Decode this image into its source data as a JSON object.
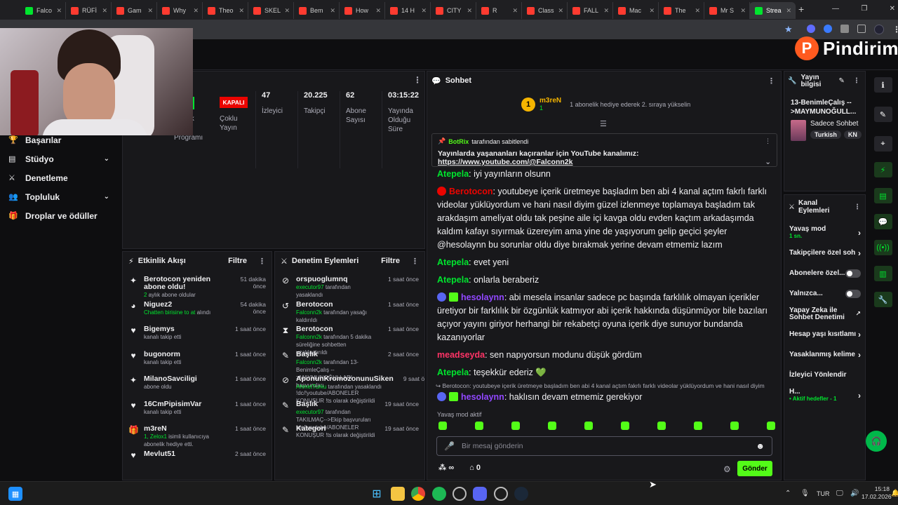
{
  "browser": {
    "tabs": [
      {
        "label": "Falco",
        "color": "#00e52e"
      },
      {
        "label": "RÜFİ",
        "color": "#ff3b30"
      },
      {
        "label": "Gam",
        "color": "#ff3b30"
      },
      {
        "label": "Why",
        "color": "#ff3b30"
      },
      {
        "label": "Theo",
        "color": "#ff3b30"
      },
      {
        "label": "SKEL",
        "color": "#ff3b30"
      },
      {
        "label": "Bem",
        "color": "#ff3b30"
      },
      {
        "label": "How",
        "color": "#ff3b30"
      },
      {
        "label": "14 H",
        "color": "#ff3b30"
      },
      {
        "label": "CITY",
        "color": "#ff3b30"
      },
      {
        "label": "R",
        "color": "#ff3b30"
      },
      {
        "label": "Class",
        "color": "#ff3b30"
      },
      {
        "label": "FALL",
        "color": "#ff3b30"
      },
      {
        "label": "Mac",
        "color": "#ff3b30"
      },
      {
        "label": "The",
        "color": "#ff3b30"
      },
      {
        "label": "Mr S",
        "color": "#ff3b30"
      },
      {
        "label": "Strea",
        "color": "#00e52e"
      }
    ],
    "new_tab": "+",
    "window_controls": [
      "—",
      "❐",
      "✕"
    ]
  },
  "brand": {
    "name": "Pindirim",
    "color": "#ff5a1f"
  },
  "left_nav": [
    {
      "label": "Başarılar",
      "icon": "trophy-icon",
      "glyph": "🏆",
      "chevron": false
    },
    {
      "label": "Stüdyo",
      "icon": "studio-icon",
      "glyph": "▤",
      "chevron": true
    },
    {
      "label": "Denetleme",
      "icon": "sword-icon",
      "glyph": "⚔",
      "chevron": false
    },
    {
      "label": "Topluluk",
      "icon": "community-icon",
      "glyph": "👥",
      "chevron": true
    },
    {
      "label": "Droplar ve ödüller",
      "icon": "gift-icon",
      "glyph": "🎁",
      "chevron": false
    }
  ],
  "stats": {
    "partial_label_1": "rlik",
    "partial_label_2": "Programı",
    "status_badge": "KAPALI",
    "multi_stream": "Çoklu Yayın",
    "items": [
      {
        "value": "47",
        "label": "İzleyici"
      },
      {
        "value": "20.225",
        "label": "Takipçi"
      },
      {
        "value": "62",
        "label": "Abone Sayısı"
      },
      {
        "value": "03:15:22",
        "label": "Yayında Olduğu Süre"
      }
    ]
  },
  "activity": {
    "title": "Etkinlik Akışı",
    "filter": "Filtre",
    "items": [
      {
        "icon": "✦",
        "name": "Berotocon yeniden abone oldu!",
        "sub_green": "2",
        "sub": " aylık abone oldular",
        "time": "51 dakika önce"
      },
      {
        "icon": "◕",
        "name": "Niguez2",
        "sub_green": "Chatten birisine to at",
        "sub": " alındı",
        "time": "54 dakika önce"
      },
      {
        "icon": "♥",
        "name": "Bigemys",
        "sub_green": "",
        "sub": "kanalı takip etti",
        "time": "1 saat önce"
      },
      {
        "icon": "♥",
        "name": "bugonorm",
        "sub_green": "",
        "sub": "kanalı takip etti",
        "time": "1 saat önce"
      },
      {
        "icon": "✦",
        "name": "MilanoSavciligi",
        "sub_green": "",
        "sub": "abone oldu",
        "time": "1 saat önce"
      },
      {
        "icon": "♥",
        "name": "16CmPipisimVar",
        "sub_green": "",
        "sub": "kanalı takip etti",
        "time": "1 saat önce"
      },
      {
        "icon": "🎁",
        "name": "m3reN",
        "sub_green": "1, Zelox1",
        "sub": " isimli kullanıcıya abonelik hediye etti.",
        "time": "1 saat önce"
      },
      {
        "icon": "♥",
        "name": "Mevlut51",
        "sub_green": "",
        "sub": "",
        "time": "2 saat önce"
      }
    ]
  },
  "moderation": {
    "title": "Denetim Eylemleri",
    "filter": "Filtre",
    "items": [
      {
        "icon": "⊘",
        "name": "orspuoglumnq",
        "sub_green": "executor97",
        "sub": " tarafından yasaklandı",
        "time": "1 saat önce"
      },
      {
        "icon": "↺",
        "name": "Berotocon",
        "sub_green": "Falconn2k",
        "sub": " tarafından yasağı kaldırıldı",
        "time": "1 saat önce"
      },
      {
        "icon": "⧗",
        "name": "Berotocon",
        "sub_green": "Falconn2k",
        "sub": " tarafından 5 dakika süreliğine sohbetten uzaklaştırıldı",
        "time": "1 saat önce"
      },
      {
        "icon": "✎",
        "name": "Başlık",
        "sub_green": "Falconn2k",
        "sub": " tarafından 13-BenimleÇalış -->MAYMUNOĞULLARI başvuruları !dc/!youtube/ABONELER KONUŞUR !ts olarak değiştirildi",
        "time": "2 saat önce"
      },
      {
        "icon": "⊘",
        "name": "AponunKromozonunuSiken",
        "sub_green": "AhmetTurku",
        "sub": " tarafından yasaklandı",
        "time": "9 saat önce"
      },
      {
        "icon": "✎",
        "name": "Başlık",
        "sub_green": "executor97",
        "sub": " tarafından TAKILMAÇ-->Ekip başvuruları !dc/!youtube/ABONELER KONUŞUR !ts olarak değiştirildi",
        "time": "19 saat önce"
      },
      {
        "icon": "✎",
        "name": "Kategori",
        "sub_green": "",
        "sub": "",
        "time": "19 saat önce"
      }
    ]
  },
  "chat": {
    "title": "Sohbet",
    "top_gifter": {
      "name": "m3reN",
      "rank": "1",
      "count": "1",
      "text": "1 abonelik hediye ederek 2. sıraya yükselin"
    },
    "pinned": {
      "by": "BotRix",
      "by_suffix": " tarafından sabitlendi",
      "text": "Yayınlarda yaşananları kaçıranlar için YouTube kanalımız: ",
      "link": "https://www.youtube.com/@Falconn2k"
    },
    "messages": [
      {
        "user": "Atepela",
        "color": "#00e52e",
        "badge": "",
        "text": ": iyi yayınların olsunn"
      },
      {
        "user": "Berotocon",
        "color": "#eb0400",
        "badge": "#eb0400",
        "text": ": youtubeye içerik üretmeye başladım ben abi 4 kanal açtım fakrlı farklı videolar yüklüyordum ve hani nasıl diyim güzel izlenmeye toplamaya başladım tak arakdaşım ameliyat oldu tak peşine aile içi kavga oldu evden kaçtım arkadaşımda kaldım kafayı sıyırmak üzereyim ama yine de yaşıyorum gelip geçici şeyler @hesolaynn bu sorunlar oldu diye bırakmak yerine devam etmemiz lazım"
      },
      {
        "user": "Atepela",
        "color": "#00e52e",
        "badge": "",
        "text": ": evet yeni"
      },
      {
        "user": "Atepela",
        "color": "#00e52e",
        "badge": "",
        "text": ": onlarla beraberiz"
      },
      {
        "user": "hesolaynn",
        "color": "#9147ff",
        "badge": "#5865f2",
        "text": ": abi mesela insanlar sadece pc başında farklılık olmayan içerikler üretiyor bir farklılık bir özgünlük katmıyor abi içerik hakkında düşünmüyor bile bazıları açıyor yayını giriyor herhangi bir rekabetçi oyuna içerik diye sunuyor bundanda kazanıyorlar"
      },
      {
        "user": "meadseyda",
        "color": "#ff3366",
        "badge": "",
        "text": ": sen napıyorsun modunu düşük gördüm"
      },
      {
        "user": "Atepela",
        "color": "#00e52e",
        "badge": "",
        "text": ": teşekkür ederiz 💚"
      }
    ],
    "reply_preview": "↪ Berotocon: youtubeye içerik üretmeye başladım ben abi 4 kanal açtım fakrlı farklı videolar yüklüyordum ve hani nasıl diyim",
    "last_message": {
      "user": "hesolaynn",
      "color": "#9147ff",
      "text": ": haklısın devam etmemiz gerekiyor"
    },
    "slow_mode": "Yavaş mod aktif",
    "placeholder": "Bir mesaj gönderin",
    "points": "0",
    "infinity": "∞",
    "send": "Gönder"
  },
  "stream_info": {
    "title": "Yayın bilgisi",
    "stream_title": "13-BenimleÇalış -->MAYMUNOĞULL...",
    "category": "Sadece Sohbet",
    "tags": [
      "Turkish",
      "KN"
    ]
  },
  "channel_actions": {
    "title": "Kanal Eylemleri",
    "items": [
      {
        "label": "Yavaş mod",
        "sub": "1 sn.",
        "control": "chevron"
      },
      {
        "label": "Takipçilere özel soh",
        "sub": "",
        "control": "chevron"
      },
      {
        "label": "Abonelere özel...",
        "sub": "",
        "control": "toggle"
      },
      {
        "label": "Yalnızca...",
        "sub": "",
        "control": "toggle"
      },
      {
        "label": "Yapay Zeka ile Sohbet Denetimi",
        "sub": "",
        "control": "external"
      },
      {
        "label": "Hesap yaşı kısıtlamı",
        "sub": "",
        "control": "chevron"
      },
      {
        "label": "Yasaklanmış kelime",
        "sub": "",
        "control": "chevron"
      },
      {
        "label": "İzleyici Yönlendir",
        "sub": "",
        "control": "none"
      },
      {
        "label": "H...",
        "sub": "• Aktif hedefler - 1",
        "control": "chevron"
      }
    ]
  },
  "taskbar": {
    "lang": "TUR",
    "time": "15:18",
    "date": "17.02.2026"
  }
}
